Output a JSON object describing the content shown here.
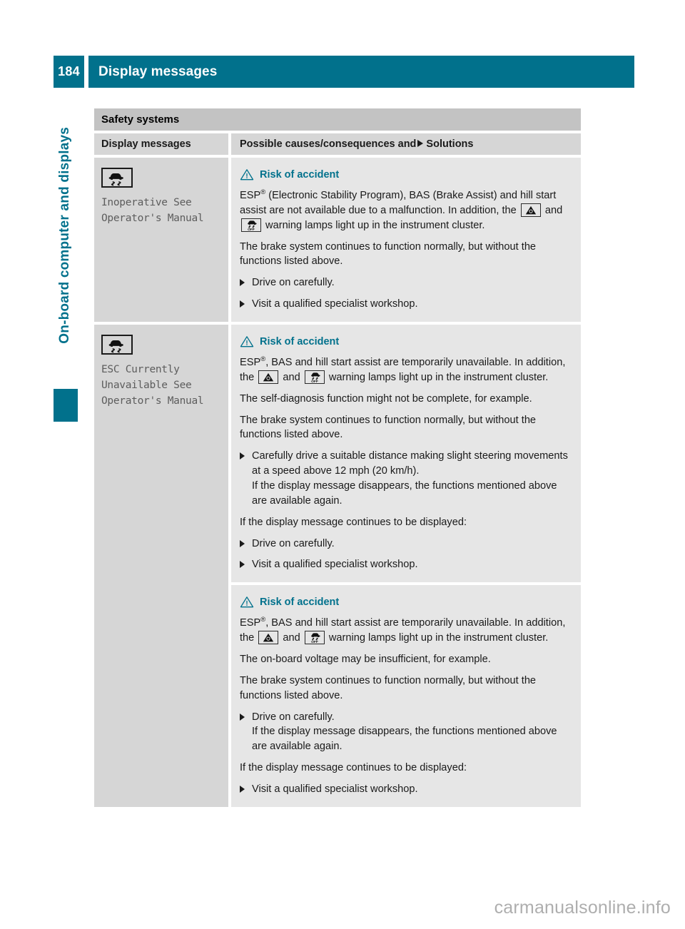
{
  "header": {
    "page_number": "184",
    "title": "Display messages"
  },
  "side_tab": {
    "label": "On-board computer and displays"
  },
  "table": {
    "section_title": "Safety systems",
    "columns": {
      "left": "Display messages",
      "right_before_arrow": "Possible causes/consequences and",
      "right_after_arrow": "Solutions"
    },
    "rows": [
      {
        "display_icon": "esp-skidding-car-icon",
        "display_message": "Inoperative See\nOperator's Manual",
        "blocks": [
          {
            "warning_heading": "Risk of accident",
            "paragraphs": [
              {
                "parts": [
                  {
                    "t": "text",
                    "v": "ESP"
                  },
                  {
                    "t": "sup",
                    "v": "®"
                  },
                  {
                    "t": "text",
                    "v": " (Electronic Stability Program), BAS (Brake Assist) and hill start assist are not available due to a malfunction. In addition, the "
                  },
                  {
                    "t": "lamp",
                    "v": "esp-warning-triangle-lamp"
                  },
                  {
                    "t": "text",
                    "v": " and "
                  },
                  {
                    "t": "lamp",
                    "v": "esp-off-lamp"
                  },
                  {
                    "t": "text",
                    "v": " warning lamps light up in the instrument cluster."
                  }
                ]
              },
              {
                "parts": [
                  {
                    "t": "text",
                    "v": "The brake system continues to function normally, but without the functions listed above."
                  }
                ]
              }
            ],
            "steps": [
              {
                "lines": [
                  "Drive on carefully."
                ]
              },
              {
                "lines": [
                  "Visit a qualified specialist workshop."
                ]
              }
            ],
            "trailing_paragraphs": []
          }
        ]
      },
      {
        "display_icon": "esp-skidding-car-icon",
        "display_message": "ESC Currently\nUnavailable See\nOperator's Manual",
        "blocks": [
          {
            "warning_heading": "Risk of accident",
            "paragraphs": [
              {
                "parts": [
                  {
                    "t": "text",
                    "v": "ESP"
                  },
                  {
                    "t": "sup",
                    "v": "®"
                  },
                  {
                    "t": "text",
                    "v": ", BAS and hill start assist are temporarily unavailable. In addition, the "
                  },
                  {
                    "t": "lamp",
                    "v": "esp-warning-triangle-lamp"
                  },
                  {
                    "t": "text",
                    "v": " and "
                  },
                  {
                    "t": "lamp",
                    "v": "esp-off-lamp"
                  },
                  {
                    "t": "text",
                    "v": " warning lamps light up in the instrument cluster."
                  }
                ]
              },
              {
                "parts": [
                  {
                    "t": "text",
                    "v": "The self-diagnosis function might not be complete, for example."
                  }
                ]
              },
              {
                "parts": [
                  {
                    "t": "text",
                    "v": "The brake system continues to function normally, but without the functions listed above."
                  }
                ]
              }
            ],
            "steps": [
              {
                "lines": [
                  "Carefully drive a suitable distance making slight steering movements at a speed above 12 mph (20 km/h).",
                  "If the display message disappears, the functions mentioned above are available again."
                ]
              }
            ],
            "trailing_paragraphs": [
              {
                "text": "If the display message continues to be displayed:"
              }
            ],
            "trailing_steps": [
              {
                "lines": [
                  "Drive on carefully."
                ]
              },
              {
                "lines": [
                  "Visit a qualified specialist workshop."
                ]
              }
            ]
          },
          {
            "warning_heading": "Risk of accident",
            "paragraphs": [
              {
                "parts": [
                  {
                    "t": "text",
                    "v": "ESP"
                  },
                  {
                    "t": "sup",
                    "v": "®"
                  },
                  {
                    "t": "text",
                    "v": ", BAS and hill start assist are temporarily unavailable. In addition, the "
                  },
                  {
                    "t": "lamp",
                    "v": "esp-warning-triangle-lamp"
                  },
                  {
                    "t": "text",
                    "v": " and "
                  },
                  {
                    "t": "lamp",
                    "v": "esp-off-lamp"
                  },
                  {
                    "t": "text",
                    "v": " warning lamps light up in the instrument cluster."
                  }
                ]
              },
              {
                "parts": [
                  {
                    "t": "text",
                    "v": "The on-board voltage may be insufficient, for example."
                  }
                ]
              },
              {
                "parts": [
                  {
                    "t": "text",
                    "v": "The brake system continues to function normally, but without the functions listed above."
                  }
                ]
              }
            ],
            "steps": [
              {
                "lines": [
                  "Drive on carefully.",
                  "If the display message disappears, the functions mentioned above are available again."
                ]
              }
            ],
            "trailing_paragraphs": [
              {
                "text": "If the display message continues to be displayed:"
              }
            ],
            "trailing_steps": [
              {
                "lines": [
                  "Visit a qualified specialist workshop."
                ]
              }
            ]
          }
        ]
      }
    ]
  },
  "watermark": "carmanualsonline.info",
  "colors": {
    "accent_teal": "#01718c",
    "section_gray": "#c3c3c3",
    "left_col_gray": "#d6d6d6",
    "right_col_gray": "#e6e6e6"
  }
}
